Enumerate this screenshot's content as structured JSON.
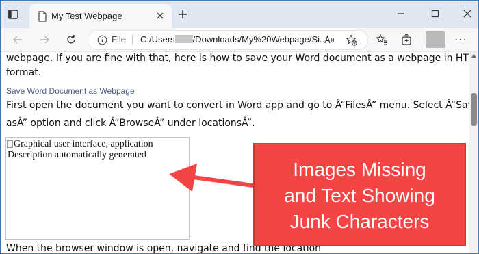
{
  "tab": {
    "title": "My Test Webpage"
  },
  "address": {
    "scheme_label": "File",
    "url_prefix": "C:/Users",
    "url_suffix": "/Downloads/My%20Webpage/Si..."
  },
  "content": {
    "para1_line1": "webpage. If you are fine with that, here is how to save your Word document as a webpage in HTML",
    "para1_line2": "format.",
    "heading": "Save Word Document as Webpage",
    "para2_line1": "First open the document you want to convert in Word app and go to Â“FilesÂ” menu. Select Â“Save",
    "para2_line2": "asÂ” option and click Â“BrowseÂ” under locationsÂ”.",
    "image_alt_line1": "Graphical user interface, application",
    "image_alt_line2": "Description automatically generated",
    "para3_partial": "When the browser window is open, navigate and find the location"
  },
  "callout": {
    "lines": [
      "Images Missing",
      "and Text Showing",
      "Junk Characters"
    ],
    "color": "#f44444"
  },
  "icons": {
    "window_menu": "sidebar-icon",
    "page": "page-icon",
    "close": "close-icon",
    "new_tab": "plus-icon",
    "back": "back-arrow-icon",
    "forward": "forward-arrow-icon",
    "refresh": "refresh-icon",
    "info": "info-icon",
    "read_aloud": "read-aloud-icon",
    "favorite": "star-add-icon",
    "favorites": "favorites-icon",
    "collections": "collections-icon"
  }
}
